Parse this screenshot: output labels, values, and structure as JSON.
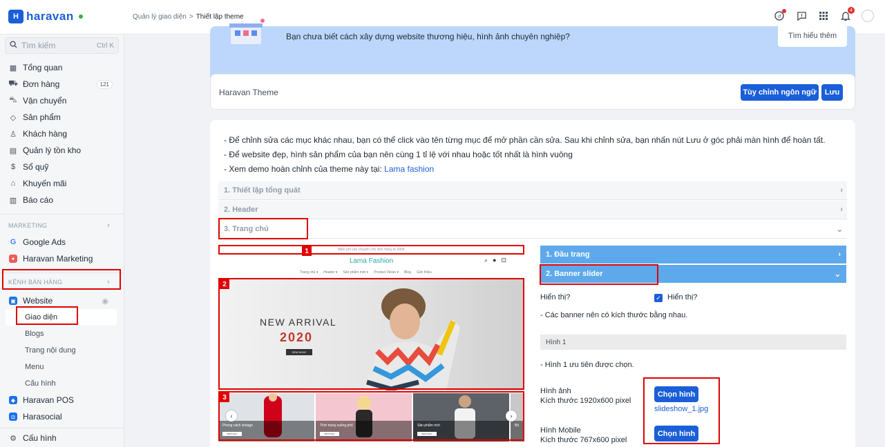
{
  "app": {
    "logo_text": "haravan",
    "logo_mark": "H",
    "brand_color": "#1a5fd8"
  },
  "breadcrumb": {
    "parent": "Quản lý giao diện",
    "separator": ">",
    "current": "Thiết lập theme"
  },
  "topbar": {
    "notification_count": "4"
  },
  "sidebar": {
    "search_placeholder": "Tìm kiếm",
    "search_shortcut": "Ctrl K",
    "items": [
      {
        "label": "Tổng quan",
        "icon": "dashboard-icon"
      },
      {
        "label": "Đơn hàng",
        "icon": "cart-icon",
        "count": "121"
      },
      {
        "label": "Vận chuyển",
        "icon": "truck-icon"
      },
      {
        "label": "Sản phẩm",
        "icon": "tag-icon"
      },
      {
        "label": "Khách hàng",
        "icon": "users-icon"
      },
      {
        "label": "Quản lý tồn kho",
        "icon": "inventory-icon"
      },
      {
        "label": "Sổ quỹ",
        "icon": "cash-icon"
      },
      {
        "label": "Khuyến mãi",
        "icon": "gift-icon"
      },
      {
        "label": "Báo cáo",
        "icon": "report-icon"
      }
    ],
    "marketing_heading": "MARKETING",
    "marketing_items": [
      {
        "label": "Google Ads"
      },
      {
        "label": "Haravan Marketing"
      }
    ],
    "sales_heading": "KÊNH BÁN HÀNG",
    "website_label": "Website",
    "website_subitems": [
      "Giao diện",
      "Blogs",
      "Trang nội dung",
      "Menu",
      "Cấu hình"
    ],
    "pos_label": "Haravan POS",
    "social_label": "Harasocial",
    "settings_label": "Cấu hình"
  },
  "promo": {
    "text": "Bạn chưa biết cách xây dựng website thương hiệu, hình ảnh chuyên nghiệp?",
    "button": "Tìm hiểu thêm"
  },
  "theme_card": {
    "title": "Haravan Theme",
    "customize_button": "Tùy chỉnh ngôn ngữ",
    "save_button": "Lưu"
  },
  "notes": {
    "line1": "- Để chỉnh sửa các mục khác nhau, bạn có thể click vào tên từng mục để mở phần cần sửa. Sau khi chỉnh sửa, bạn nhấn nút Lưu ở góc phải màn hình để hoàn tất.",
    "line2": "- Để website đẹp, hình sản phẩm của bạn nên cùng 1 tỉ lệ với nhau hoặc tốt nhất là hình vuông",
    "line3_prefix": "- Xem demo hoàn chỉnh của theme này tại:",
    "line3_link": "Lama fashion"
  },
  "accordion": {
    "general": "1. Thiết lập tổng quát",
    "header": "2. Header",
    "home": "3. Trang chủ"
  },
  "preview": {
    "topbar_text": "Miễn phí vận chuyển cho đơn hàng từ 300K",
    "brand": "Lama Fashion",
    "menu": [
      "Trang chủ ▾",
      "Header ▾",
      "Sản phẩm mới ▾",
      "Product Views ▾",
      "Blog",
      "Giới thiệu"
    ],
    "banner_title": "NEW ARRIVAL",
    "banner_year": "2020",
    "banner_button": "XEM NGAY",
    "categories": [
      {
        "caption": "Phong cách vintage",
        "button": "XEM NGAY"
      },
      {
        "caption": "Thời trang xuống phố",
        "button": "XEM NGAY"
      },
      {
        "caption": "Sản phẩm mới",
        "button": "XEM NGAY"
      },
      {
        "caption": "Bộ",
        "button": ""
      }
    ],
    "markers": [
      "1",
      "2",
      "3"
    ]
  },
  "settings": {
    "section1": "1. Đầu trang",
    "section2": "2. Banner slider",
    "show_label": "Hiển thị?",
    "show_checkbox_label": "Hiển thị?",
    "show_checked": true,
    "banner_note": "- Các banner nên có kích thước bằng nhau.",
    "image1_heading": "Hình 1",
    "image1_note": "- Hình 1 ưu tiên được chọn.",
    "image_label": "Hình ảnh",
    "image_size": "Kích thước 1920x600 pixel",
    "choose_button": "Chọn hình",
    "image_file": "slideshow_1.jpg",
    "mobile_label": "Hình Mobile",
    "mobile_size": "Kích thước 767x600 pixel",
    "choose_button_mobile": "Chọn hình"
  },
  "colors": {
    "highlight": "#e00000",
    "accordion_active": "#5da9ec",
    "promo_bg": "#bcd7fb"
  }
}
